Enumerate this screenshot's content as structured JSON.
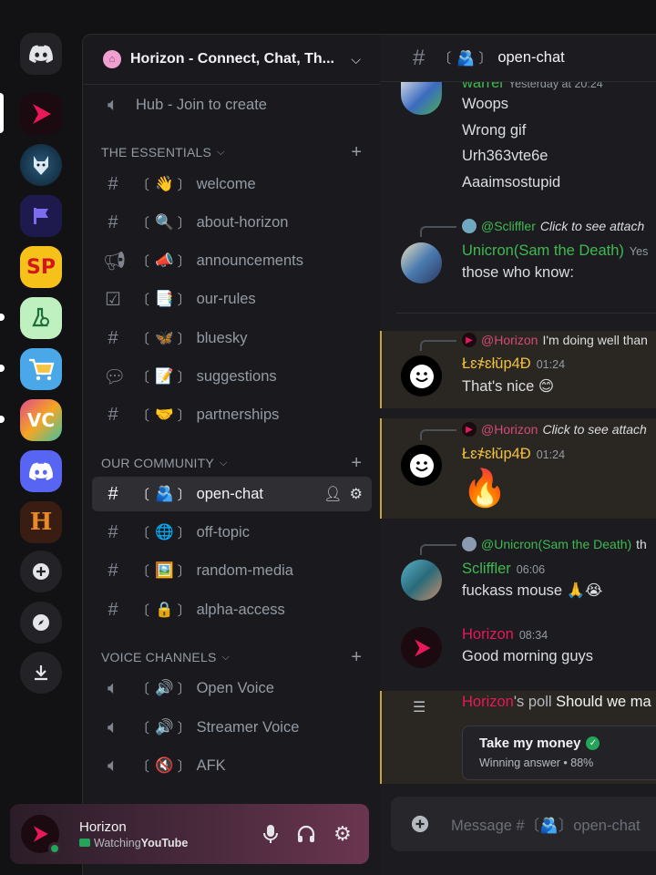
{
  "guild": {
    "name": "Horizon - Connect, Chat, Th..."
  },
  "sidebar": {
    "top_channel": "Hub - Join to create",
    "categories": [
      {
        "label": "THE ESSENTIALS",
        "channels": [
          {
            "emoji": "👋",
            "name": "welcome"
          },
          {
            "emoji": "🔍",
            "name": "about-horizon"
          },
          {
            "emoji": "📣",
            "name": "announcements"
          },
          {
            "emoji": "📑",
            "name": "our-rules"
          },
          {
            "emoji": "🦋",
            "name": "bluesky"
          },
          {
            "emoji": "📝",
            "name": "suggestions"
          },
          {
            "emoji": "🤝",
            "name": "partnerships"
          }
        ]
      },
      {
        "label": "OUR COMMUNITY",
        "channels": [
          {
            "emoji": "🫂",
            "name": "open-chat"
          },
          {
            "emoji": "🌐",
            "name": "off-topic"
          },
          {
            "emoji": "🖼️",
            "name": "random-media"
          },
          {
            "emoji": "🔒",
            "name": "alpha-access"
          }
        ]
      },
      {
        "label": "VOICE CHANNELS",
        "channels": [
          {
            "emoji": "🔊",
            "name": "Open Voice"
          },
          {
            "emoji": "🔊",
            "name": "Streamer Voice"
          },
          {
            "emoji": "🔇",
            "name": "AFK"
          }
        ]
      }
    ]
  },
  "user": {
    "name": "Horizon",
    "status_prefix": "Watching ",
    "status_app": "YouTube"
  },
  "chat": {
    "channel_emoji": "🫂",
    "channel_name": "open-chat",
    "messages": [
      {
        "author": "warrel",
        "time": "Yesterday at 20:24",
        "lines": [
          "Woops",
          "Wrong gif",
          "Urh363vte6e",
          "Aaaimsostupid"
        ]
      },
      {
        "reply_to": "@Scliffler",
        "reply_text": "Click to see attach",
        "author": "Unicron(Sam the Death)",
        "time": "Yes",
        "lines": [
          "those who know:"
        ]
      },
      {
        "reply_to": "@Horizon",
        "reply_text": "I'm doing well than",
        "author": "Łɛ҂ɛłǔp4Đ",
        "time": "01:24",
        "lines": [
          "That's nice 😊"
        ]
      },
      {
        "reply_to": "@Horizon",
        "reply_text": "Click to see attach",
        "author": "Łɛ҂ɛłǔp4Đ",
        "time": "01:24",
        "lines": [
          "🔥"
        ]
      },
      {
        "reply_to": "@Unicron(Sam the Death)",
        "reply_text": "th",
        "author": "Scliffler",
        "time": "06:06",
        "lines": [
          "fuckass mouse 🙏😭"
        ]
      },
      {
        "author": "Horizon",
        "time": "08:34",
        "lines": [
          "Good morning guys"
        ]
      }
    ],
    "poll": {
      "author": "Horizon",
      "suffix": "'s poll",
      "question": "Should we ma",
      "option": "Take my money",
      "result": "Winning answer • 88%"
    },
    "composer_placeholder": "Message #〔🫂〕open-chat"
  },
  "colors": {
    "accent_green": "#23a55a",
    "horizon_red": "#e8185a",
    "mention_pink": "#d24b7a",
    "gold_author": "#f0c040"
  }
}
